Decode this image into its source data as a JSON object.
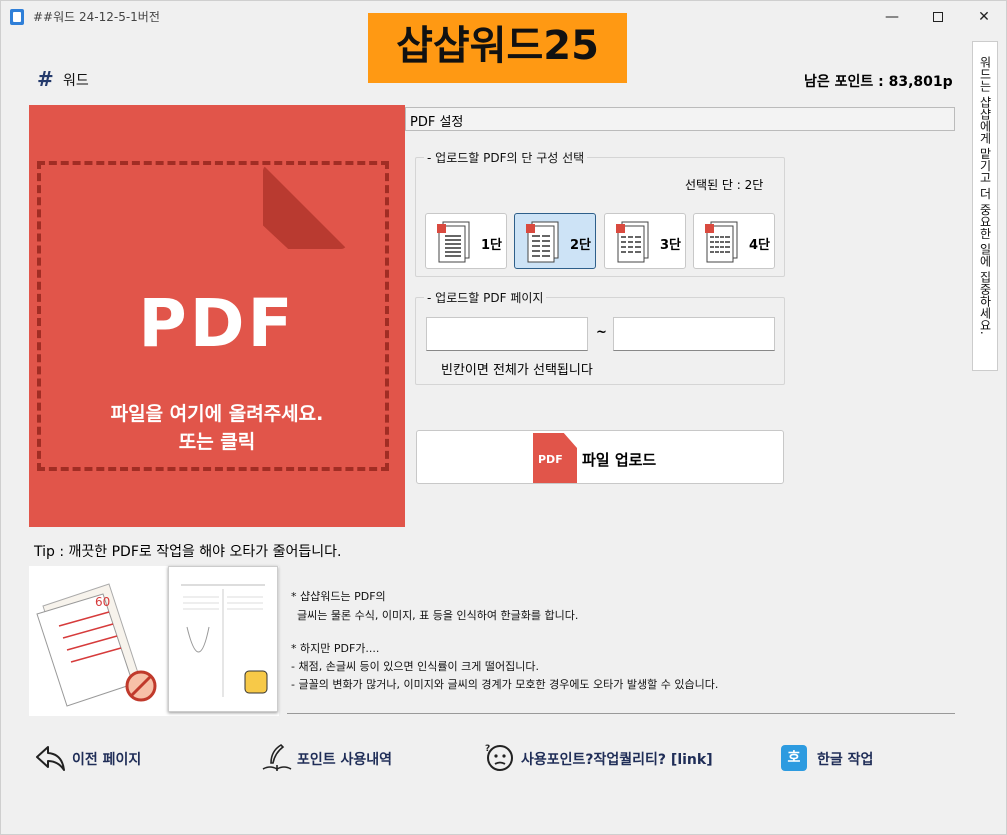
{
  "window": {
    "title": "##워드 24-12-5-1버전"
  },
  "brand": {
    "banner": "샵샵워드25"
  },
  "header": {
    "logo_mark": "#",
    "section_label": "워드",
    "points": "남은 포인트 : 83,801p"
  },
  "side_tab": {
    "text": "워드는 샵샵에게 맡기고 더 중요한 일에 집중하세요."
  },
  "drop_zone": {
    "big_label": "PDF",
    "message_line1": "파일을 여기에 올려주세요.",
    "message_line2": "또는 클릭"
  },
  "settings": {
    "header": "PDF 설정",
    "columns_group": {
      "legend": "업로드할 PDF의 단 구성 선택",
      "selected_text": "선택된 단 : 2단",
      "options": [
        "1단",
        "2단",
        "3단",
        "4단"
      ],
      "selected_index": 1
    },
    "pages_group": {
      "legend": "업로드할 PDF 페이지",
      "from_value": "",
      "to_value": "",
      "separator": "~",
      "hint": "빈칸이면 전체가 선택됩니다"
    },
    "upload_button": {
      "icon_text": "PDF",
      "label": "파일 업로드"
    }
  },
  "tip": "Tip : 깨끗한 PDF로 작업을 해야 오타가 줄어듭니다.",
  "info": {
    "lines": [
      "* 샵샵워드는 PDF의",
      "글씨는 물론 수식, 이미지, 표 등을 인식하여 한글화를 합니다.",
      "* 하지만 PDF가....",
      "- 채점, 손글씨 등이 있으면 인식률이 크게 떨어집니다.",
      "- 글꼴의 변화가 많거나, 이미지와 글씨의 경계가 모호한 경우에도 오타가 발생할 수 있습니다."
    ]
  },
  "footer": {
    "prev_page": "이전 페이지",
    "point_history": "포인트 사용내역",
    "quality_link": "사용포인트?작업퀄리티? [link]",
    "hangul_icon": "호",
    "hangul_work": "한글 작업"
  }
}
